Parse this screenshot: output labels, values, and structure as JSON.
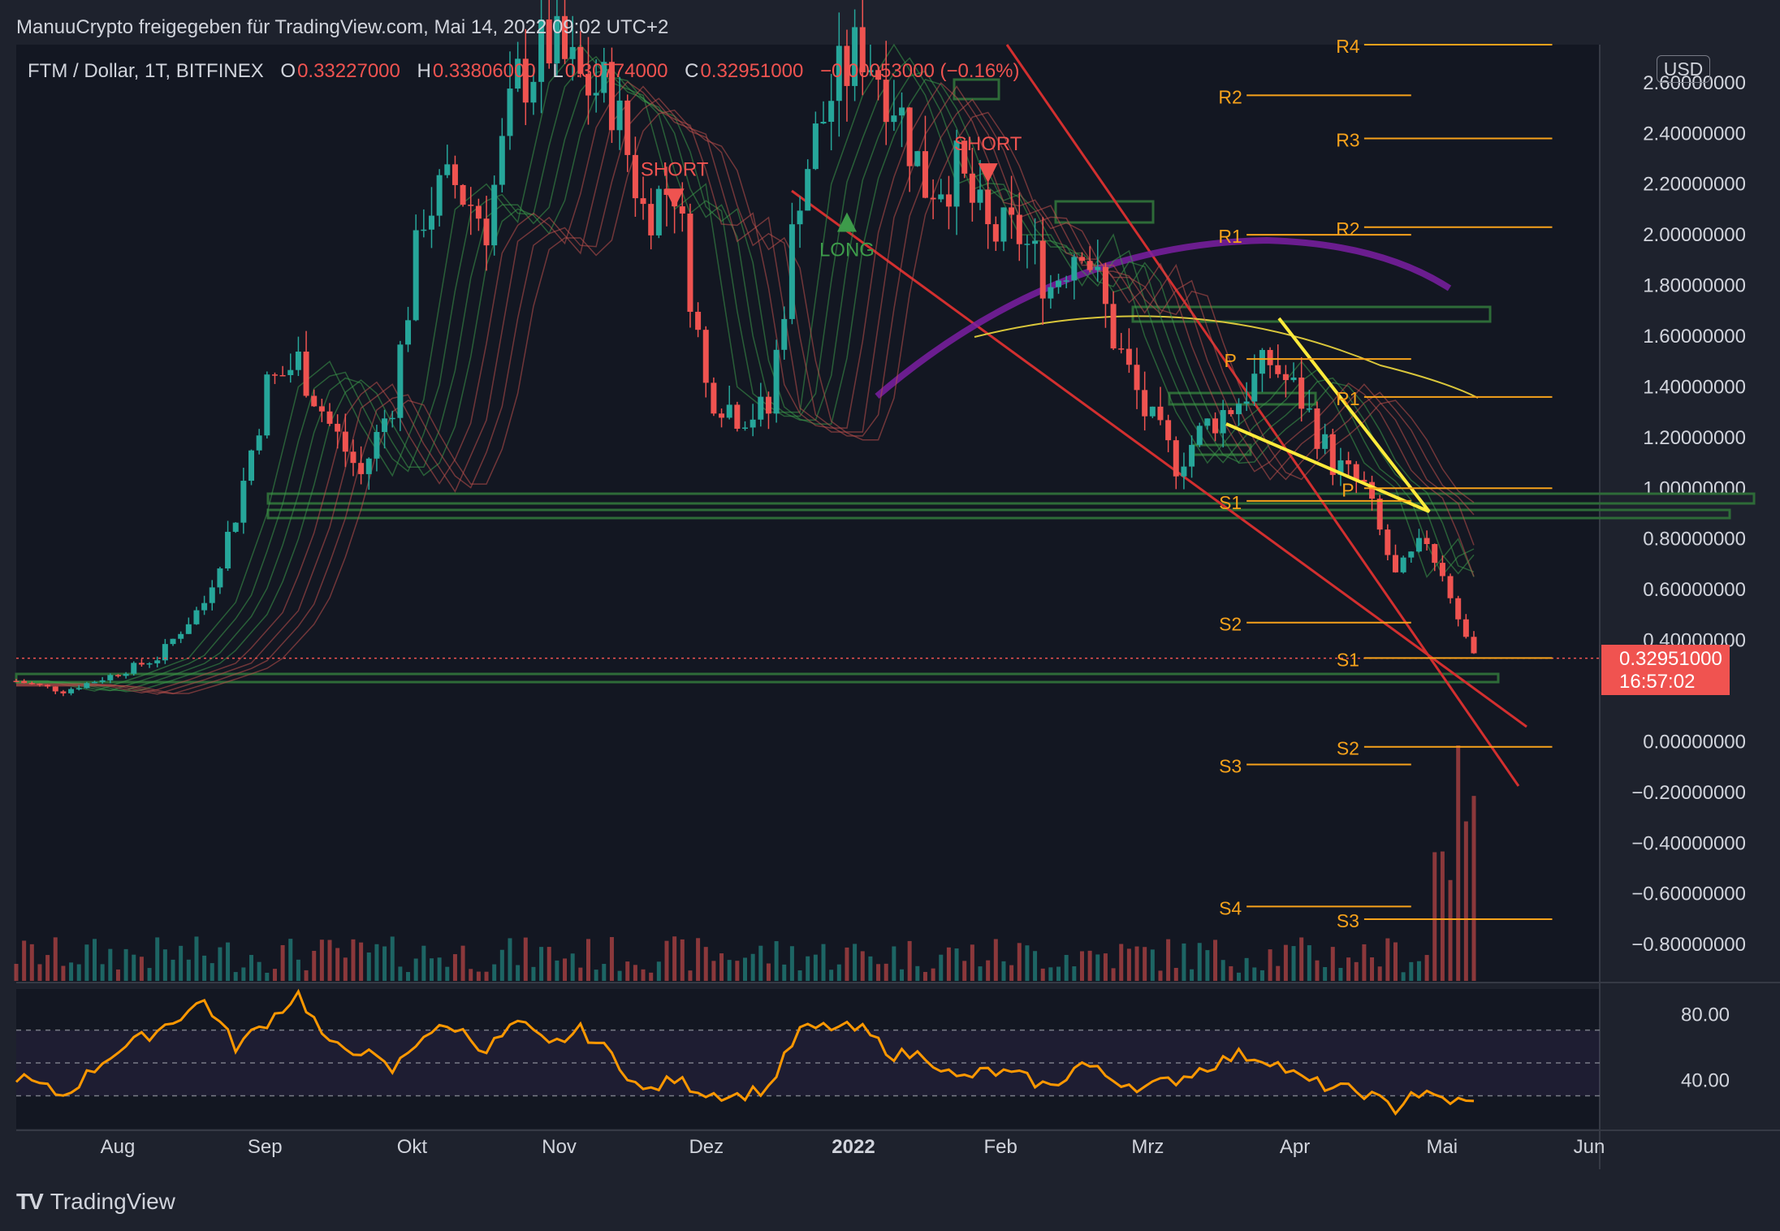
{
  "header": {
    "publisher": "ManuuCrypto freigegeben für TradingView.com, Mai 14, 2022 09:02 UTC+2",
    "symbol": "FTM / Dollar, 1T, BITFINEX",
    "open_label": "O",
    "open": "0.33227000",
    "high_label": "H",
    "high": "0.33806000",
    "low_label": "L",
    "low": "0.30774000",
    "close_label": "C",
    "close": "0.32951000",
    "change": "−0.00053000 (−0.16%)"
  },
  "currency": "USD",
  "last_price": "0.32951000",
  "countdown": "16:57:02",
  "brand": "TradingView",
  "colors": {
    "background": "#1e222d",
    "up": "#26a69a",
    "down": "#ef5350",
    "pivot": "#f7a21b",
    "trendline": "#d32f2f",
    "triangle": "#ffeb3b",
    "zone": "#2e6b38",
    "rsi": "#ff9800",
    "ema200": "#d9c63b",
    "arc": "#7b1fa2"
  },
  "chart_data": {
    "type": "candlestick",
    "x_labels": [
      "Aug",
      "Sep",
      "Okt",
      "Nov",
      "Dez",
      "2022",
      "Feb",
      "Mrz",
      "Apr",
      "Mai",
      "Jun"
    ],
    "price_axis": [
      "2.60000000",
      "2.40000000",
      "2.20000000",
      "2.00000000",
      "1.80000000",
      "1.60000000",
      "1.40000000",
      "1.20000000",
      "1.00000000",
      "0.80000000",
      "0.60000000",
      "0.40000000",
      "0.00000000",
      "−0.20000000",
      "−0.40000000",
      "−0.60000000",
      "−0.80000000"
    ],
    "price_axis_values": [
      2.6,
      2.4,
      2.2,
      2.0,
      1.8,
      1.6,
      1.4,
      1.2,
      1.0,
      0.8,
      0.6,
      0.4,
      0.0,
      -0.2,
      -0.4,
      -0.6,
      -0.8
    ],
    "ylim": [
      -0.95,
      2.75
    ],
    "price_path": [
      [
        0,
        0.24
      ],
      [
        6,
        0.2
      ],
      [
        12,
        0.26
      ],
      [
        18,
        0.33
      ],
      [
        24,
        0.55
      ],
      [
        28,
        0.9
      ],
      [
        32,
        1.4
      ],
      [
        36,
        1.5
      ],
      [
        40,
        1.25
      ],
      [
        44,
        1.05
      ],
      [
        48,
        1.35
      ],
      [
        52,
        2.1
      ],
      [
        56,
        2.2
      ],
      [
        60,
        2.05
      ],
      [
        64,
        2.6
      ],
      [
        68,
        2.75
      ],
      [
        72,
        2.6
      ],
      [
        76,
        2.55
      ],
      [
        80,
        2.1
      ],
      [
        84,
        2.2
      ],
      [
        88,
        1.4
      ],
      [
        92,
        1.3
      ],
      [
        96,
        1.3
      ],
      [
        100,
        2.2
      ],
      [
        104,
        2.55
      ],
      [
        108,
        2.75
      ],
      [
        112,
        2.55
      ],
      [
        116,
        2.2
      ],
      [
        120,
        2.25
      ],
      [
        124,
        2.0
      ],
      [
        128,
        2.0
      ],
      [
        132,
        1.8
      ],
      [
        136,
        2.0
      ],
      [
        140,
        1.6
      ],
      [
        144,
        1.3
      ],
      [
        148,
        1.1
      ],
      [
        152,
        1.25
      ],
      [
        156,
        1.35
      ],
      [
        160,
        1.5
      ],
      [
        164,
        1.35
      ],
      [
        168,
        1.1
      ],
      [
        172,
        1.0
      ],
      [
        176,
        0.65
      ],
      [
        180,
        0.8
      ],
      [
        184,
        0.5
      ],
      [
        186,
        0.33
      ]
    ],
    "signals": [
      {
        "label": "SHORT",
        "type": "sell",
        "x": 84,
        "price": 2.15
      },
      {
        "label": "LONG",
        "type": "buy",
        "x": 106,
        "price": 2.05
      },
      {
        "label": "SHORT",
        "type": "sell",
        "x": 124,
        "price": 2.25
      }
    ],
    "pivot_levels": [
      {
        "label": "R4",
        "price": 2.75,
        "x1": 172,
        "x2": 196
      },
      {
        "label": "R2",
        "price": 2.55,
        "x1": 157,
        "x2": 178
      },
      {
        "label": "R3",
        "price": 2.38,
        "x1": 172,
        "x2": 196
      },
      {
        "label": "R1",
        "price": 2.0,
        "x1": 157,
        "x2": 178
      },
      {
        "label": "R2",
        "price": 2.03,
        "x1": 172,
        "x2": 196
      },
      {
        "label": "P",
        "price": 1.51,
        "x1": 157,
        "x2": 178
      },
      {
        "label": "R1",
        "price": 1.36,
        "x1": 172,
        "x2": 196
      },
      {
        "label": "S1",
        "price": 0.95,
        "x1": 157,
        "x2": 178
      },
      {
        "label": "P",
        "price": 1.0,
        "x1": 172,
        "x2": 196
      },
      {
        "label": "S2",
        "price": 0.47,
        "x1": 157,
        "x2": 178
      },
      {
        "label": "S1",
        "price": 0.33,
        "x1": 172,
        "x2": 196
      },
      {
        "label": "S3",
        "price": -0.09,
        "x1": 157,
        "x2": 178
      },
      {
        "label": "S2",
        "price": -0.02,
        "x1": 172,
        "x2": 196
      },
      {
        "label": "S4",
        "price": -0.65,
        "x1": 157,
        "x2": 178
      },
      {
        "label": "S3",
        "price": -0.7,
        "x1": 172,
        "x2": 196
      }
    ],
    "rsi": {
      "levels": [
        "80.00",
        "40.00"
      ],
      "level_values": [
        80,
        40
      ],
      "band": [
        30,
        70
      ],
      "mid": 50,
      "ylim": [
        10,
        95
      ],
      "path": [
        [
          0,
          42
        ],
        [
          6,
          30
        ],
        [
          12,
          55
        ],
        [
          18,
          70
        ],
        [
          24,
          88
        ],
        [
          28,
          60
        ],
        [
          32,
          75
        ],
        [
          36,
          92
        ],
        [
          40,
          60
        ],
        [
          44,
          58
        ],
        [
          48,
          45
        ],
        [
          52,
          68
        ],
        [
          56,
          72
        ],
        [
          60,
          58
        ],
        [
          64,
          75
        ],
        [
          68,
          60
        ],
        [
          72,
          70
        ],
        [
          76,
          55
        ],
        [
          80,
          32
        ],
        [
          84,
          40
        ],
        [
          88,
          32
        ],
        [
          92,
          30
        ],
        [
          96,
          35
        ],
        [
          100,
          70
        ],
        [
          104,
          72
        ],
        [
          108,
          70
        ],
        [
          112,
          55
        ],
        [
          116,
          55
        ],
        [
          120,
          40
        ],
        [
          124,
          45
        ],
        [
          128,
          42
        ],
        [
          132,
          35
        ],
        [
          136,
          50
        ],
        [
          140,
          40
        ],
        [
          144,
          35
        ],
        [
          148,
          40
        ],
        [
          152,
          48
        ],
        [
          156,
          55
        ],
        [
          160,
          52
        ],
        [
          164,
          40
        ],
        [
          168,
          35
        ],
        [
          172,
          32
        ],
        [
          176,
          22
        ],
        [
          178,
          32
        ],
        [
          182,
          28
        ],
        [
          186,
          25
        ]
      ]
    }
  }
}
